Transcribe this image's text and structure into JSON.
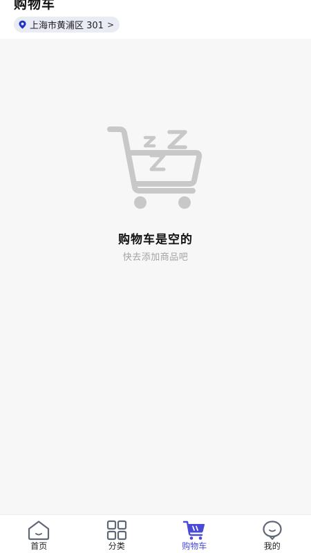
{
  "header": {
    "title": "购物车",
    "location": {
      "text": "上海市黄浦区 301",
      "chevron": ">",
      "icon": "location-pin-icon",
      "icon_color": "#1f2fc9"
    }
  },
  "empty_state": {
    "illustration": "sleeping-cart-icon",
    "title": "购物车是空的",
    "subtitle": "快去添加商品吧"
  },
  "tabbar": {
    "active_color": "#4a4ad6",
    "items": [
      {
        "label": "首页",
        "icon": "home-icon",
        "active": false
      },
      {
        "label": "分类",
        "icon": "grid-icon",
        "active": false
      },
      {
        "label": "购物车",
        "icon": "cart-icon",
        "active": true
      },
      {
        "label": "我的",
        "icon": "profile-icon",
        "active": false
      }
    ]
  }
}
